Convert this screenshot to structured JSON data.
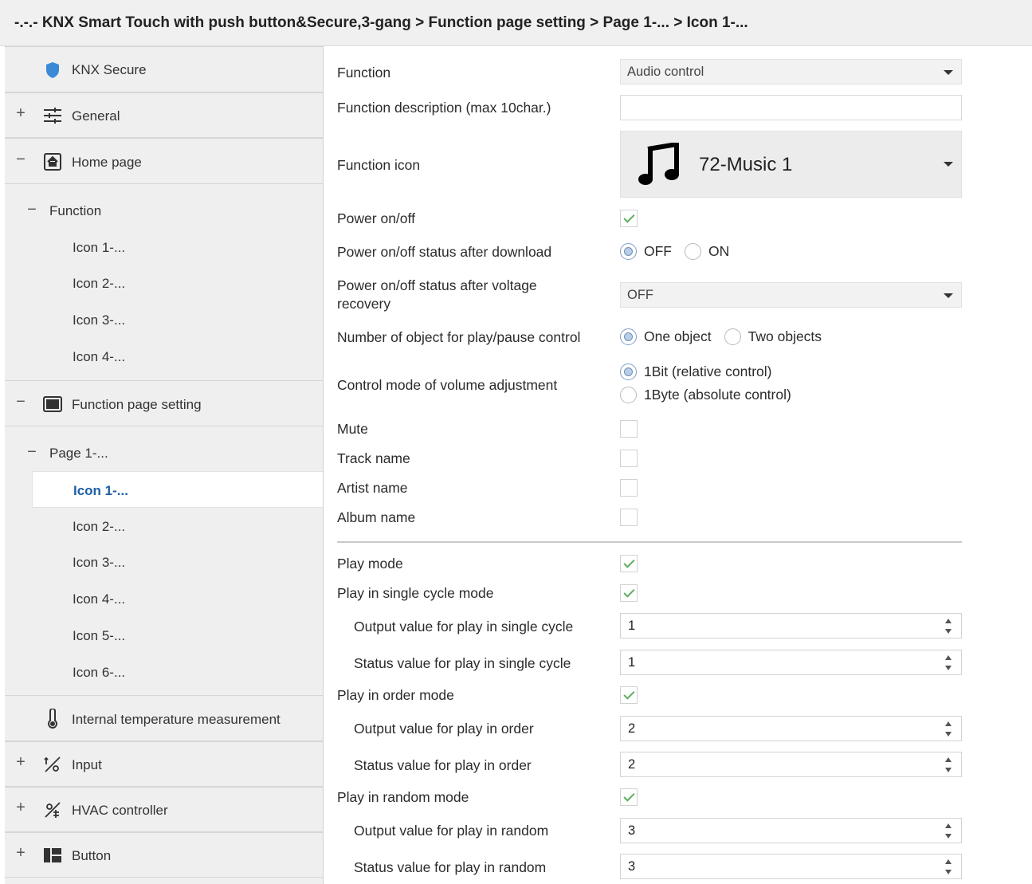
{
  "breadcrumb": "-.-.- KNX Smart Touch with push button&Secure,3-gang > Function page setting > Page 1-... > Icon 1-...",
  "sidebar": {
    "knx_secure": "KNX Secure",
    "general": "General",
    "home_page": "Home page",
    "function": "Function",
    "home_icons": [
      "Icon 1-...",
      "Icon 2-...",
      "Icon 3-...",
      "Icon 4-..."
    ],
    "function_page_setting": "Function page setting",
    "page1": "Page 1-...",
    "page_icons": [
      "Icon 1-...",
      "Icon 2-...",
      "Icon 3-...",
      "Icon 4-...",
      "Icon 5-...",
      "Icon 6-..."
    ],
    "internal_temp": "Internal temperature measurement",
    "input": "Input",
    "hvac": "HVAC controller",
    "button": "Button",
    "expand_plus": "+",
    "collapse_minus": "−"
  },
  "form": {
    "function": {
      "label": "Function",
      "value": "Audio control"
    },
    "description": {
      "label": "Function description (max 10char.)",
      "value": ""
    },
    "icon": {
      "label": "Function icon",
      "value": "72-Music 1",
      "icon": "music-note-icon"
    },
    "power": {
      "label": "Power on/off",
      "checked": true
    },
    "power_after_download": {
      "label": "Power on/off  status after download",
      "options": [
        "OFF",
        "ON"
      ],
      "selected": "OFF"
    },
    "power_after_voltage": {
      "label_line1": "Power on/off status after voltage",
      "label_line2": "recovery",
      "value": "OFF"
    },
    "num_objects": {
      "label": "Number of object for play/pause control",
      "options": [
        "One object",
        "Two objects"
      ],
      "selected": "One object"
    },
    "volume_mode": {
      "label": "Control mode of volume adjustment",
      "options": [
        "1Bit (relative control)",
        "1Byte (absolute control)"
      ],
      "selected": "1Bit (relative control)"
    },
    "mute": {
      "label": "Mute",
      "checked": false
    },
    "track_name": {
      "label": "Track name",
      "checked": false
    },
    "artist_name": {
      "label": "Artist name",
      "checked": false
    },
    "album_name": {
      "label": "Album name",
      "checked": false
    },
    "play_mode": {
      "label": "Play mode",
      "checked": true
    },
    "single_cycle": {
      "label": "Play in single cycle mode",
      "checked": true
    },
    "single_output": {
      "label": "Output value for play in single cycle",
      "value": "1"
    },
    "single_status": {
      "label": "Status value for  play in single cycle",
      "value": "1"
    },
    "order_mode": {
      "label": "Play in order mode",
      "checked": true
    },
    "order_output": {
      "label": "Output value for play in order",
      "value": "2"
    },
    "order_status": {
      "label": "Status value for play in order",
      "value": "2"
    },
    "random_mode": {
      "label": "Play in random mode",
      "checked": true
    },
    "random_output": {
      "label": "Output value for play in random",
      "value": "3"
    },
    "random_status": {
      "label": "Status value for play in random",
      "value": "3"
    }
  },
  "colors": {
    "accent": "#1d5fa6",
    "check": "#5fae5c",
    "shield": "#3a8ad6"
  }
}
